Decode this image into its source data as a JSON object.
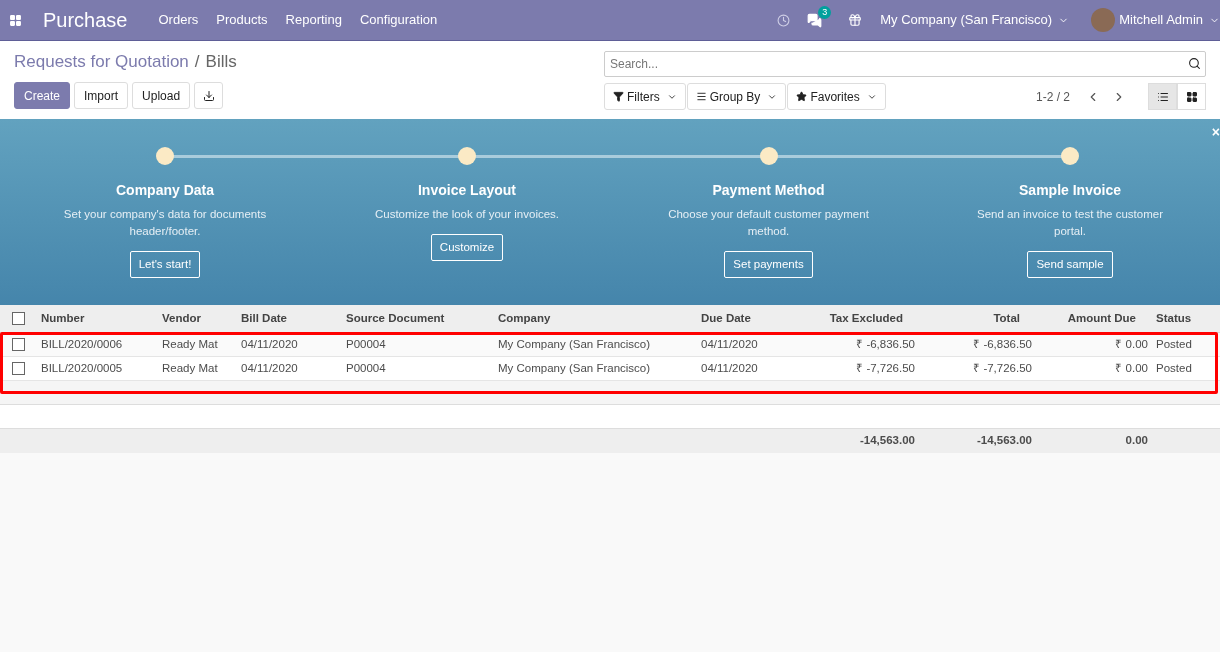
{
  "navbar": {
    "app_title": "Purchase",
    "menu": [
      "Orders",
      "Products",
      "Reporting",
      "Configuration"
    ],
    "messages_badge": "3",
    "company": "My Company (San Francisco)",
    "user": "Mitchell Admin"
  },
  "breadcrumb": {
    "parent": "Requests for Quotation",
    "separator": "/",
    "current": "Bills"
  },
  "actions": [
    "Create",
    "Import",
    "Upload"
  ],
  "search": {
    "placeholder": "Search..."
  },
  "filters": [
    "Filters",
    "Group By",
    "Favorites"
  ],
  "pager": "1-2 / 2",
  "views": [
    {
      "kind": "list",
      "selected": true
    },
    {
      "kind": "kanban",
      "selected": false
    }
  ],
  "onboarding": {
    "close": "×",
    "steps": [
      {
        "title": "Company Data",
        "description": "Set your company's data for documents header/footer.",
        "button": "Let's start!"
      },
      {
        "title": "Invoice Layout",
        "description": "Customize the look of your invoices.",
        "button": "Customize"
      },
      {
        "title": "Payment Method",
        "description": "Choose your default customer payment method.",
        "button": "Set payments"
      },
      {
        "title": "Sample Invoice",
        "description": "Send an invoice to test the customer portal.",
        "button": "Send sample"
      }
    ]
  },
  "table": {
    "all_checked": false,
    "columns": [
      "Number",
      "Vendor",
      "Bill Date",
      "Source Document",
      "Company",
      "Due Date",
      "Tax Excluded",
      "Total",
      "Amount Due",
      "Status"
    ],
    "rows": [
      {
        "checked": false,
        "cells": [
          "BILL/2020/0006",
          "Ready Mat",
          "04/11/2020",
          "P00004",
          "My Company (San Francisco)",
          "04/11/2020",
          "₹ -6,836.50",
          "₹ -6,836.50",
          "₹ 0.00",
          "Posted"
        ]
      },
      {
        "checked": false,
        "cells": [
          "BILL/2020/0005",
          "Ready Mat",
          "04/11/2020",
          "P00004",
          "My Company (San Francisco)",
          "04/11/2020",
          "₹ -7,726.50",
          "₹ -7,726.50",
          "₹ 0.00",
          "Posted"
        ]
      }
    ],
    "totals": [
      "-14,563.00",
      "-14,563.00",
      "0.00"
    ]
  }
}
